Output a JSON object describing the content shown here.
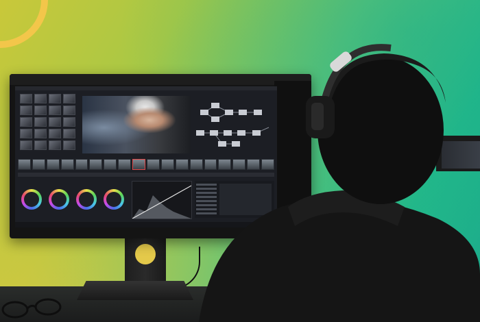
{
  "scene": {
    "description_tags": [
      "color-grading-workstation",
      "person-with-headphones",
      "monitor"
    ],
    "colors": {
      "background_green": "#23b889",
      "background_yellow": "#c9c83a",
      "ring_accent": "#f3c64a",
      "screen_bg": "#1c1e24"
    }
  },
  "icons": {
    "headphones": "headphones-icon",
    "glasses": "glasses-icon"
  }
}
